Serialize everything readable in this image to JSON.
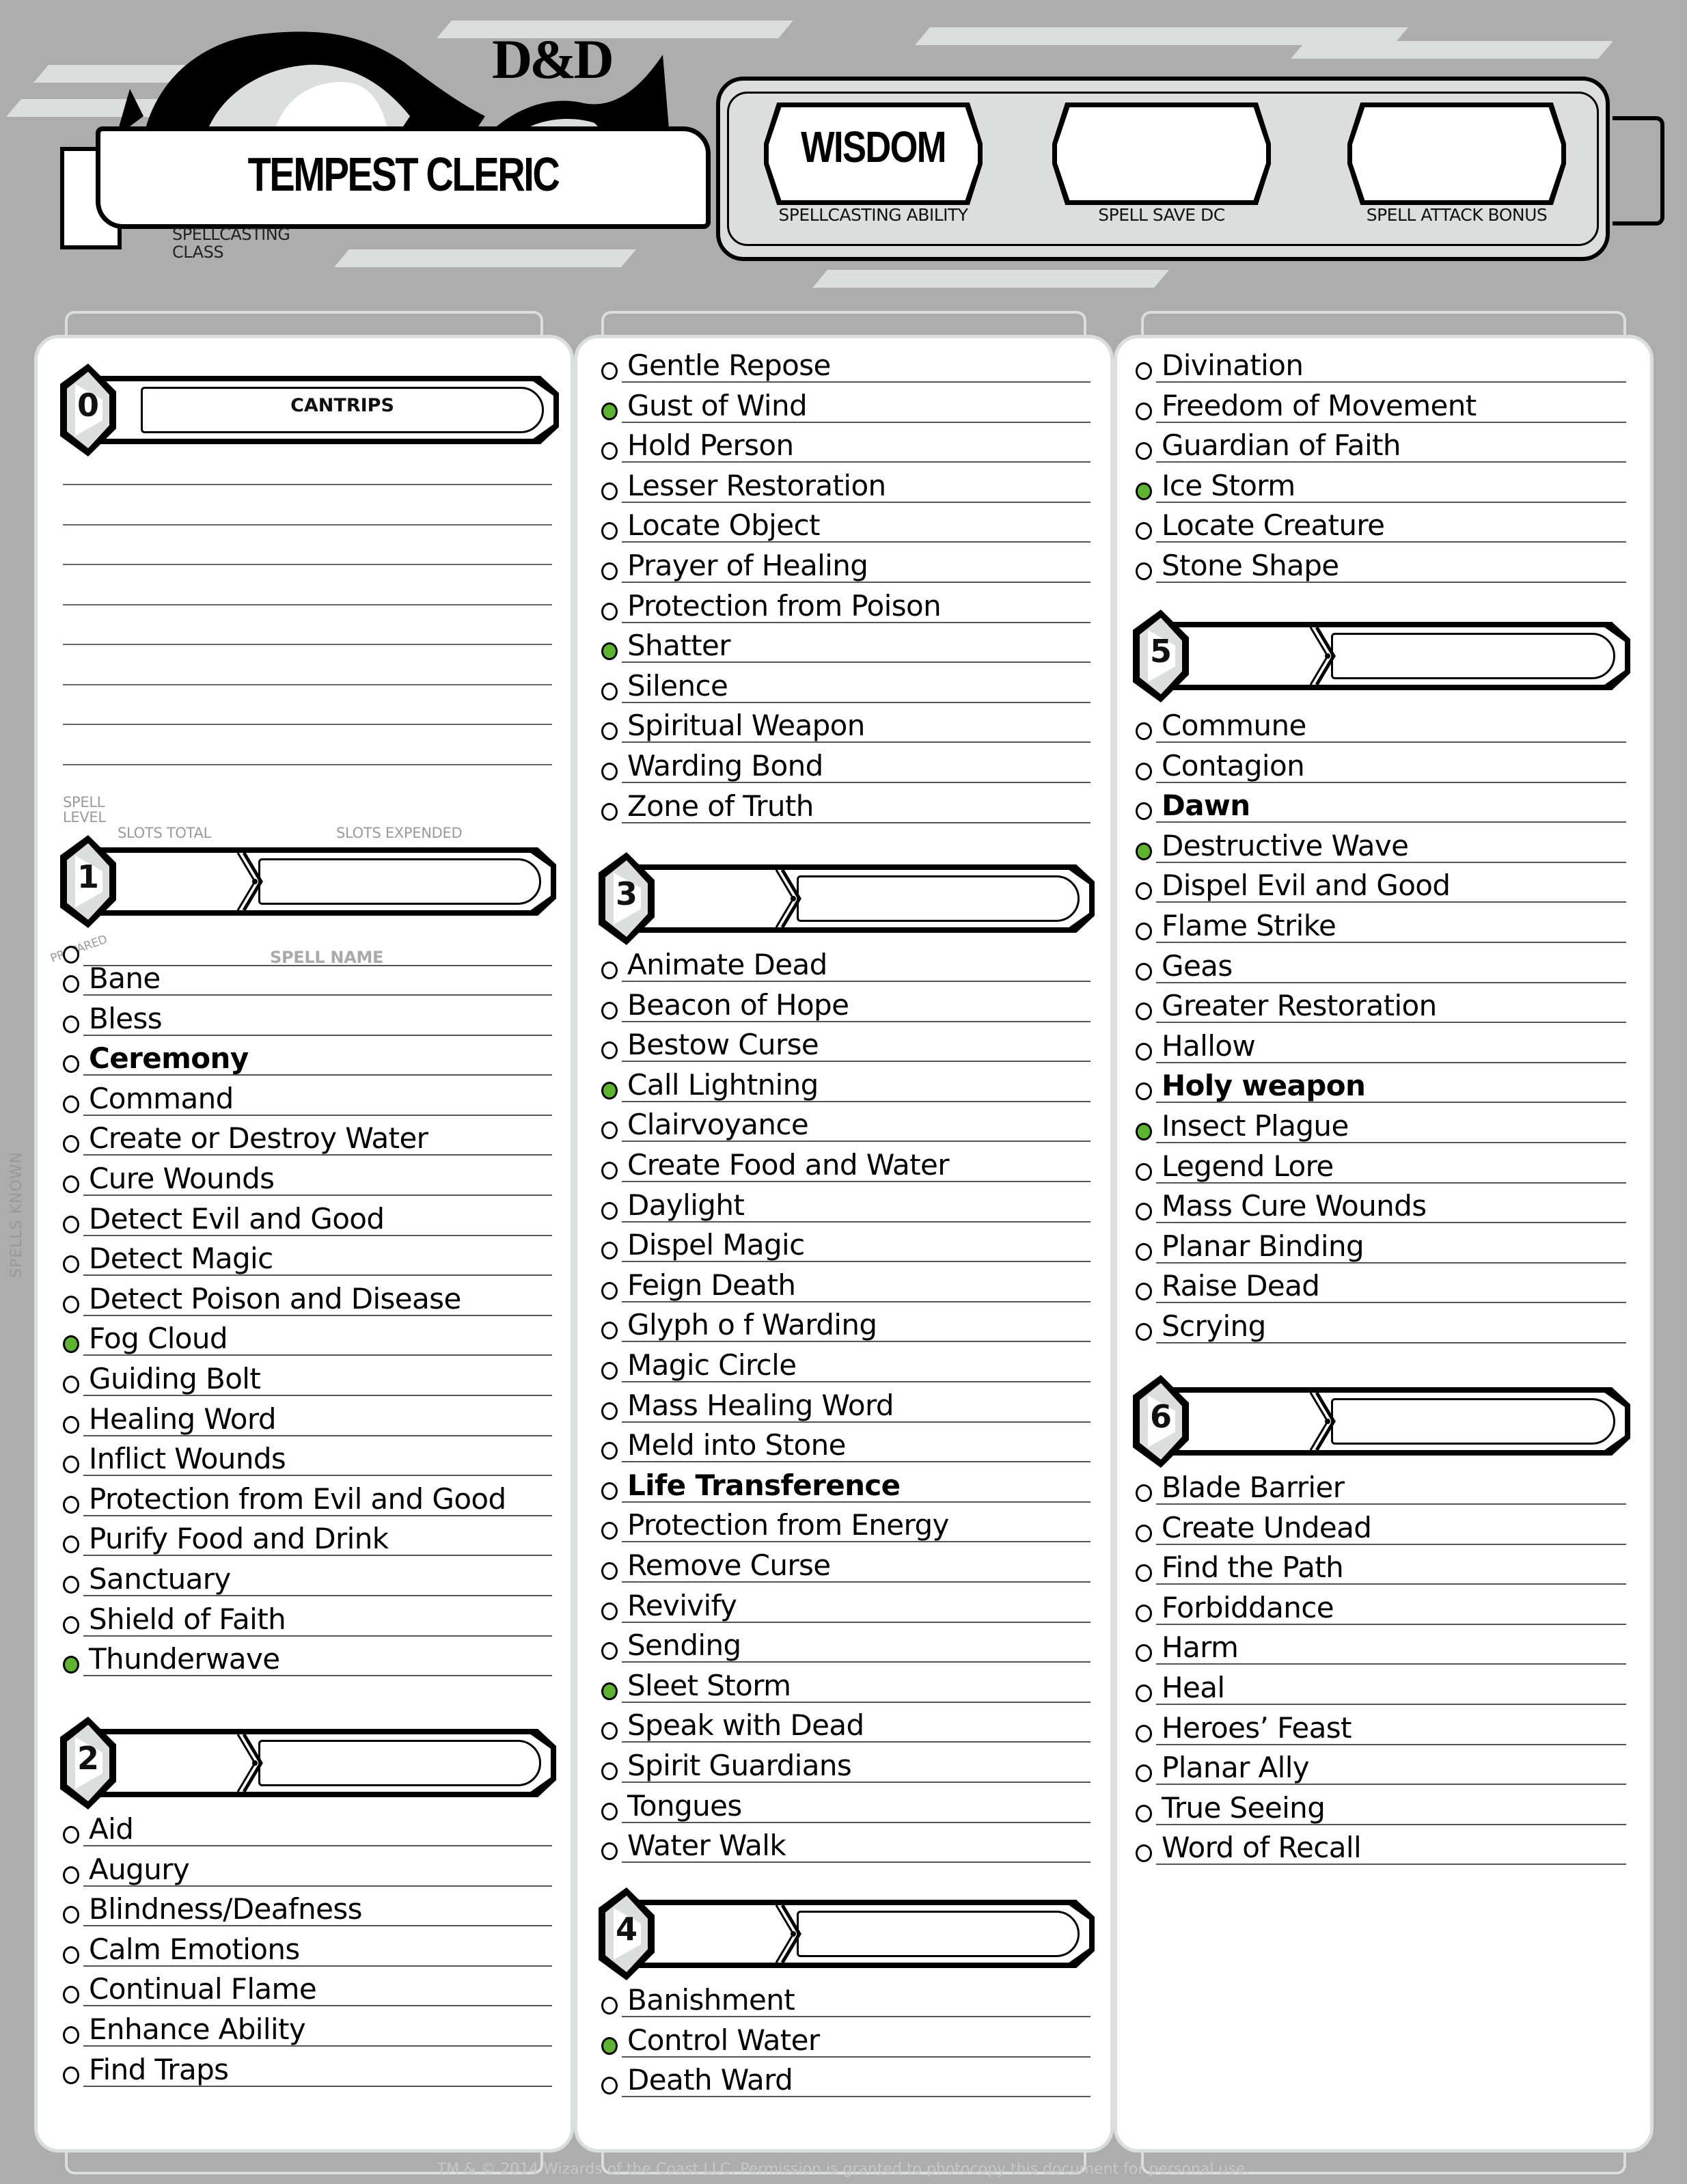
{
  "header": {
    "logo_text": "D&D",
    "spellcasting_class": "TEMPEST CLERIC",
    "spellcasting_class_label": "SPELLCASTING CLASS",
    "spellcasting_ability": "WISDOM",
    "spellcasting_ability_label": "SPELLCASTING ABILITY",
    "spell_save_dc": "",
    "spell_save_dc_label": "SPELL SAVE DC",
    "spell_attack_bonus": "",
    "spell_attack_bonus_label": "SPELL ATTACK BONUS"
  },
  "labels": {
    "cantrips": "CANTRIPS",
    "spell_level": "SPELL LEVEL",
    "slots_total": "SLOTS TOTAL",
    "slots_expended": "SLOTS EXPENDED",
    "prepared": "PREPARED",
    "spell_name": "SPELL NAME",
    "spells_known": "SPELLS KNOWN"
  },
  "colors": {
    "prepared_marker": "#5db52f",
    "background": "#adadad"
  },
  "cantrips": {
    "level": "0",
    "entries": [
      "",
      "",
      "",
      "",
      "",
      "",
      "",
      ""
    ]
  },
  "levels": [
    {
      "level": "1",
      "slots_total": "",
      "slots_expended": "",
      "spells": [
        {
          "name": "Bane",
          "prepared": false,
          "bold": false
        },
        {
          "name": "Bless",
          "prepared": false,
          "bold": false
        },
        {
          "name": "Ceremony",
          "prepared": false,
          "bold": true
        },
        {
          "name": "Command",
          "prepared": false,
          "bold": false
        },
        {
          "name": "Create or Destroy Water",
          "prepared": false,
          "bold": false
        },
        {
          "name": "Cure Wounds",
          "prepared": false,
          "bold": false
        },
        {
          "name": "Detect Evil and Good",
          "prepared": false,
          "bold": false
        },
        {
          "name": "Detect Magic",
          "prepared": false,
          "bold": false
        },
        {
          "name": "Detect Poison and Disease",
          "prepared": false,
          "bold": false
        },
        {
          "name": "Fog Cloud",
          "prepared": true,
          "bold": false
        },
        {
          "name": "Guiding Bolt",
          "prepared": false,
          "bold": false
        },
        {
          "name": "Healing Word",
          "prepared": false,
          "bold": false
        },
        {
          "name": "Inflict Wounds",
          "prepared": false,
          "bold": false
        },
        {
          "name": "Protection from Evil and Good",
          "prepared": false,
          "bold": false
        },
        {
          "name": "Purify Food and Drink",
          "prepared": false,
          "bold": false
        },
        {
          "name": "Sanctuary",
          "prepared": false,
          "bold": false
        },
        {
          "name": "Shield of Faith",
          "prepared": false,
          "bold": false
        },
        {
          "name": "Thunderwave",
          "prepared": true,
          "bold": false
        }
      ]
    },
    {
      "level": "2",
      "slots_total": "",
      "slots_expended": "",
      "spells": [
        {
          "name": "Aid",
          "prepared": false,
          "bold": false
        },
        {
          "name": "Augury",
          "prepared": false,
          "bold": false
        },
        {
          "name": "Blindness/Deafness",
          "prepared": false,
          "bold": false
        },
        {
          "name": "Calm Emotions",
          "prepared": false,
          "bold": false
        },
        {
          "name": "Continual Flame",
          "prepared": false,
          "bold": false
        },
        {
          "name": "Enhance Ability",
          "prepared": false,
          "bold": false
        },
        {
          "name": "Find Traps",
          "prepared": false,
          "bold": false
        },
        {
          "name": "Gentle Repose",
          "prepared": false,
          "bold": false
        },
        {
          "name": "Gust of Wind",
          "prepared": true,
          "bold": false
        },
        {
          "name": "Hold Person",
          "prepared": false,
          "bold": false
        },
        {
          "name": "Lesser Restoration",
          "prepared": false,
          "bold": false
        },
        {
          "name": "Locate Object",
          "prepared": false,
          "bold": false
        },
        {
          "name": "Prayer of Healing",
          "prepared": false,
          "bold": false
        },
        {
          "name": "Protection from Poison",
          "prepared": false,
          "bold": false
        },
        {
          "name": "Shatter",
          "prepared": true,
          "bold": false
        },
        {
          "name": "Silence",
          "prepared": false,
          "bold": false
        },
        {
          "name": "Spiritual Weapon",
          "prepared": false,
          "bold": false
        },
        {
          "name": "Warding Bond",
          "prepared": false,
          "bold": false
        },
        {
          "name": "Zone of Truth",
          "prepared": false,
          "bold": false
        }
      ]
    },
    {
      "level": "3",
      "slots_total": "",
      "slots_expended": "",
      "spells": [
        {
          "name": "Animate Dead",
          "prepared": false,
          "bold": false
        },
        {
          "name": "Beacon of Hope",
          "prepared": false,
          "bold": false
        },
        {
          "name": "Bestow Curse",
          "prepared": false,
          "bold": false
        },
        {
          "name": "Call Lightning",
          "prepared": true,
          "bold": false
        },
        {
          "name": "Clairvoyance",
          "prepared": false,
          "bold": false
        },
        {
          "name": "Create Food and Water",
          "prepared": false,
          "bold": false
        },
        {
          "name": "Daylight",
          "prepared": false,
          "bold": false
        },
        {
          "name": "Dispel Magic",
          "prepared": false,
          "bold": false
        },
        {
          "name": "Feign Death",
          "prepared": false,
          "bold": false
        },
        {
          "name": "Glyph o f Warding",
          "prepared": false,
          "bold": false
        },
        {
          "name": "Magic Circle",
          "prepared": false,
          "bold": false
        },
        {
          "name": "Mass Healing Word",
          "prepared": false,
          "bold": false
        },
        {
          "name": "Meld into Stone",
          "prepared": false,
          "bold": false
        },
        {
          "name": "Life Transference",
          "prepared": false,
          "bold": true
        },
        {
          "name": "Protection from Energy",
          "prepared": false,
          "bold": false
        },
        {
          "name": "Remove Curse",
          "prepared": false,
          "bold": false
        },
        {
          "name": "Revivify",
          "prepared": false,
          "bold": false
        },
        {
          "name": "Sending",
          "prepared": false,
          "bold": false
        },
        {
          "name": "Sleet Storm",
          "prepared": true,
          "bold": false
        },
        {
          "name": "Speak with Dead",
          "prepared": false,
          "bold": false
        },
        {
          "name": "Spirit Guardians",
          "prepared": false,
          "bold": false
        },
        {
          "name": "Tongues",
          "prepared": false,
          "bold": false
        },
        {
          "name": "Water Walk",
          "prepared": false,
          "bold": false
        }
      ]
    },
    {
      "level": "4",
      "slots_total": "",
      "slots_expended": "",
      "spells": [
        {
          "name": "Banishment",
          "prepared": false,
          "bold": false
        },
        {
          "name": "Control Water",
          "prepared": true,
          "bold": false
        },
        {
          "name": "Death Ward",
          "prepared": false,
          "bold": false
        },
        {
          "name": "Divination",
          "prepared": false,
          "bold": false
        },
        {
          "name": "Freedom of Movement",
          "prepared": false,
          "bold": false
        },
        {
          "name": "Guardian of Faith",
          "prepared": false,
          "bold": false
        },
        {
          "name": "Ice Storm",
          "prepared": true,
          "bold": false
        },
        {
          "name": "Locate Creature",
          "prepared": false,
          "bold": false
        },
        {
          "name": "Stone Shape",
          "prepared": false,
          "bold": false
        }
      ]
    },
    {
      "level": "5",
      "slots_total": "",
      "slots_expended": "",
      "spells": [
        {
          "name": "Commune",
          "prepared": false,
          "bold": false
        },
        {
          "name": "Contagion",
          "prepared": false,
          "bold": false
        },
        {
          "name": "Dawn",
          "prepared": false,
          "bold": true
        },
        {
          "name": "Destructive Wave",
          "prepared": true,
          "bold": false
        },
        {
          "name": "Dispel Evil and Good",
          "prepared": false,
          "bold": false
        },
        {
          "name": "Flame Strike",
          "prepared": false,
          "bold": false
        },
        {
          "name": "Geas",
          "prepared": false,
          "bold": false
        },
        {
          "name": "Greater Restoration",
          "prepared": false,
          "bold": false
        },
        {
          "name": "Hallow",
          "prepared": false,
          "bold": false
        },
        {
          "name": "Holy weapon",
          "prepared": false,
          "bold": true
        },
        {
          "name": "Insect Plague",
          "prepared": true,
          "bold": false
        },
        {
          "name": "Legend Lore",
          "prepared": false,
          "bold": false
        },
        {
          "name": "Mass Cure Wounds",
          "prepared": false,
          "bold": false
        },
        {
          "name": "Planar Binding",
          "prepared": false,
          "bold": false
        },
        {
          "name": "Raise Dead",
          "prepared": false,
          "bold": false
        },
        {
          "name": "Scrying",
          "prepared": false,
          "bold": false
        }
      ]
    },
    {
      "level": "6",
      "slots_total": "",
      "slots_expended": "",
      "spells": [
        {
          "name": "Blade Barrier",
          "prepared": false,
          "bold": false
        },
        {
          "name": "Create Undead",
          "prepared": false,
          "bold": false
        },
        {
          "name": "Find the Path",
          "prepared": false,
          "bold": false
        },
        {
          "name": "Forbiddance",
          "prepared": false,
          "bold": false
        },
        {
          "name": "Harm",
          "prepared": false,
          "bold": false
        },
        {
          "name": "Heal",
          "prepared": false,
          "bold": false
        },
        {
          "name": "Heroes’ Feast",
          "prepared": false,
          "bold": false
        },
        {
          "name": "Planar Ally",
          "prepared": false,
          "bold": false
        },
        {
          "name": "True Seeing",
          "prepared": false,
          "bold": false
        },
        {
          "name": "Word of Recall",
          "prepared": false,
          "bold": false
        }
      ]
    }
  ],
  "footer": "TM & © 2014 Wizards of the Coast LLC. Permission is granted to photocopy this document for personal use."
}
